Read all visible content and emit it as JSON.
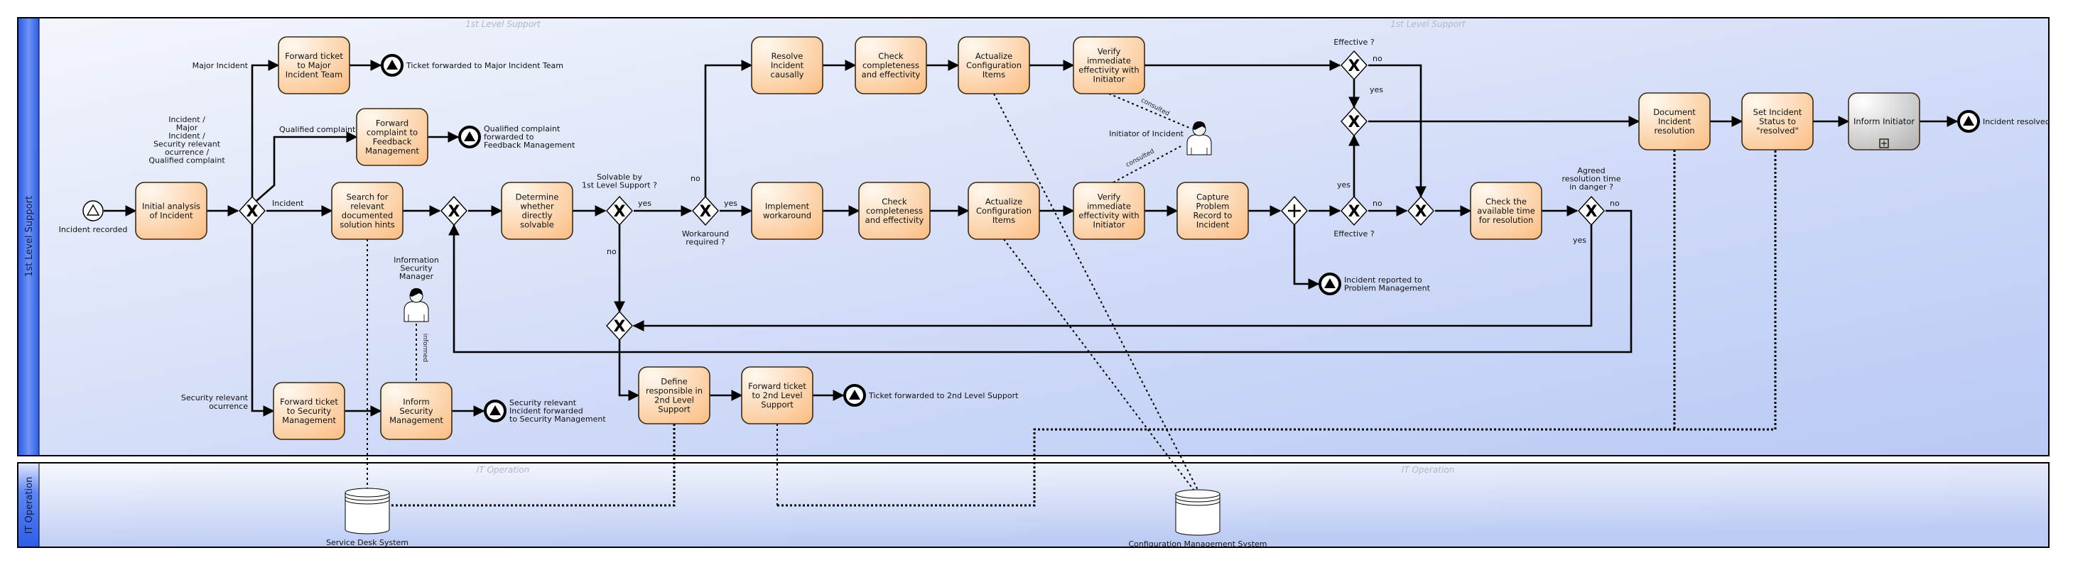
{
  "pool": {
    "lanes": [
      {
        "id": "lane-1st",
        "title": "1st Level Support",
        "watermarks": [
          "1st Level Support",
          "1st Level Support"
        ]
      },
      {
        "id": "lane-itop",
        "title": "IT Operation",
        "watermarks": [
          "IT Operation",
          "IT Operation"
        ]
      }
    ]
  },
  "colors": {
    "task_fill_top": "#fff4e8",
    "task_fill_bottom": "#fbc58c",
    "subprocess_fill_top": "#ffffff",
    "subprocess_fill_bottom": "#b8b8b8",
    "lane_bg_light": "#f4f6fc",
    "lane_bg_dark": "#b9c9f5",
    "lane_header": "#3f6ef0"
  },
  "tasks": [
    {
      "id": "t_initial",
      "lines": [
        "Initial analysis",
        "of Incident"
      ]
    },
    {
      "id": "t_major",
      "lines": [
        "Forward ticket",
        "to Major",
        "Incident Team"
      ]
    },
    {
      "id": "t_feedback",
      "lines": [
        "Forward",
        "complaint to",
        "Feedback",
        "Management"
      ]
    },
    {
      "id": "t_search",
      "lines": [
        "Search for",
        "relevant",
        "documented",
        "solution hints"
      ]
    },
    {
      "id": "t_fwdsec",
      "lines": [
        "Forward ticket",
        "to Security",
        "Management"
      ]
    },
    {
      "id": "t_infosec",
      "lines": [
        "Inform",
        "Security",
        "Management"
      ]
    },
    {
      "id": "t_determine",
      "lines": [
        "Determine",
        "whether",
        "directly",
        "solvable"
      ]
    },
    {
      "id": "t_resolve",
      "lines": [
        "Resolve",
        "Incident",
        "causally"
      ]
    },
    {
      "id": "t_check1",
      "lines": [
        "Check",
        "completeness",
        "and effectivity"
      ]
    },
    {
      "id": "t_actual1",
      "lines": [
        "Actualize",
        "Configuration",
        "Items"
      ]
    },
    {
      "id": "t_verify1",
      "lines": [
        "Verify",
        "immediate",
        "effectivity with",
        "Initiator"
      ]
    },
    {
      "id": "t_workaround",
      "lines": [
        "Implement",
        "workaround"
      ]
    },
    {
      "id": "t_check2",
      "lines": [
        "Check",
        "completeness",
        "and effectivity"
      ]
    },
    {
      "id": "t_actual2",
      "lines": [
        "Actualize",
        "Configuration",
        "Items"
      ]
    },
    {
      "id": "t_verify2",
      "lines": [
        "Verify",
        "immediate",
        "effectivity with",
        "Initiator"
      ]
    },
    {
      "id": "t_capture",
      "lines": [
        "Capture",
        "Problem",
        "Record to",
        "Incident"
      ]
    },
    {
      "id": "t_checktime",
      "lines": [
        "Check the",
        "available time",
        "for resolution"
      ]
    },
    {
      "id": "t_define2nd",
      "lines": [
        "Define",
        "responsible in",
        "2nd Level",
        "Support"
      ]
    },
    {
      "id": "t_fwd2nd",
      "lines": [
        "Forward ticket",
        "to 2nd Level",
        "Support"
      ]
    },
    {
      "id": "t_document",
      "lines": [
        "Document",
        "Incident",
        "resolution"
      ]
    },
    {
      "id": "t_setstatus",
      "lines": [
        "Set Incident",
        "Status to",
        "\"resolved\""
      ]
    },
    {
      "id": "t_inform",
      "lines": [
        "Inform Initiator"
      ],
      "subprocess": true
    }
  ],
  "events": [
    {
      "id": "e_start",
      "type": "start",
      "lines": [
        "Incident recorded"
      ]
    },
    {
      "id": "e_major",
      "type": "end",
      "lines": [
        "Ticket forwarded to Major Incident Team"
      ]
    },
    {
      "id": "e_feedback",
      "type": "end",
      "lines": [
        "Qualified complaint",
        "forwarded to",
        "Feedback Management"
      ]
    },
    {
      "id": "e_security",
      "type": "end",
      "lines": [
        "Security relevant",
        "Incident forwarded",
        "to Security Management"
      ]
    },
    {
      "id": "e_2nd",
      "type": "end",
      "lines": [
        "Ticket forwarded to 2nd Level Support"
      ]
    },
    {
      "id": "e_problem",
      "type": "end",
      "lines": [
        "Incident reported to",
        "Problem Management"
      ]
    },
    {
      "id": "e_resolved",
      "type": "end",
      "lines": [
        "Incident resolved"
      ]
    }
  ],
  "gateways": [
    {
      "id": "g_type",
      "type": "xor",
      "lines": [
        "Incident  /",
        "Major",
        "Incident  /",
        "Security relevant",
        "ocurrence  /",
        "Qualified complaint"
      ]
    },
    {
      "id": "g_merge1",
      "type": "xor",
      "lines": []
    },
    {
      "id": "g_solvable",
      "type": "xor",
      "lines": [
        "Solvable by",
        "1st Level Support ?"
      ]
    },
    {
      "id": "g_workaround",
      "type": "xor",
      "lines": [
        "Workaround",
        "required ?"
      ]
    },
    {
      "id": "g_merge2nd",
      "type": "xor",
      "lines": []
    },
    {
      "id": "g_eff1",
      "type": "xor",
      "lines": [
        "Effective ?"
      ]
    },
    {
      "id": "g_merge_res",
      "type": "xor",
      "lines": []
    },
    {
      "id": "g_parallel",
      "type": "and",
      "lines": []
    },
    {
      "id": "g_eff2",
      "type": "xor",
      "lines": [
        "Effective ?"
      ]
    },
    {
      "id": "g_merge_no",
      "type": "xor",
      "lines": []
    },
    {
      "id": "g_danger",
      "type": "xor",
      "lines": [
        "Agreed",
        "resolution time",
        "in danger ?"
      ]
    }
  ],
  "flow_labels": {
    "major": "Major Incident",
    "qualified": "Qualified complaint",
    "incident": "Incident",
    "security": [
      "Security relevant",
      "ocurrence"
    ],
    "solvable_yes": "yes",
    "solvable_no": "no",
    "workaround_no": "no",
    "workaround_yes": "yes",
    "eff1_no": "no",
    "eff1_yes": "yes",
    "eff2_yes": "yes",
    "eff2_no": "no",
    "danger_no": "no",
    "danger_yes": "yes"
  },
  "participants": [
    {
      "id": "p_initiator",
      "lines": [
        "Initiator of Incident"
      ]
    },
    {
      "id": "p_ism",
      "lines": [
        "Information",
        "Security",
        "Manager"
      ]
    }
  ],
  "association_labels": {
    "consulted": "consulted",
    "informed": "informed"
  },
  "data_stores": [
    {
      "id": "ds_sds",
      "lines": [
        "Service Desk System"
      ]
    },
    {
      "id": "ds_cms",
      "lines": [
        "Configuration Management System"
      ]
    }
  ]
}
